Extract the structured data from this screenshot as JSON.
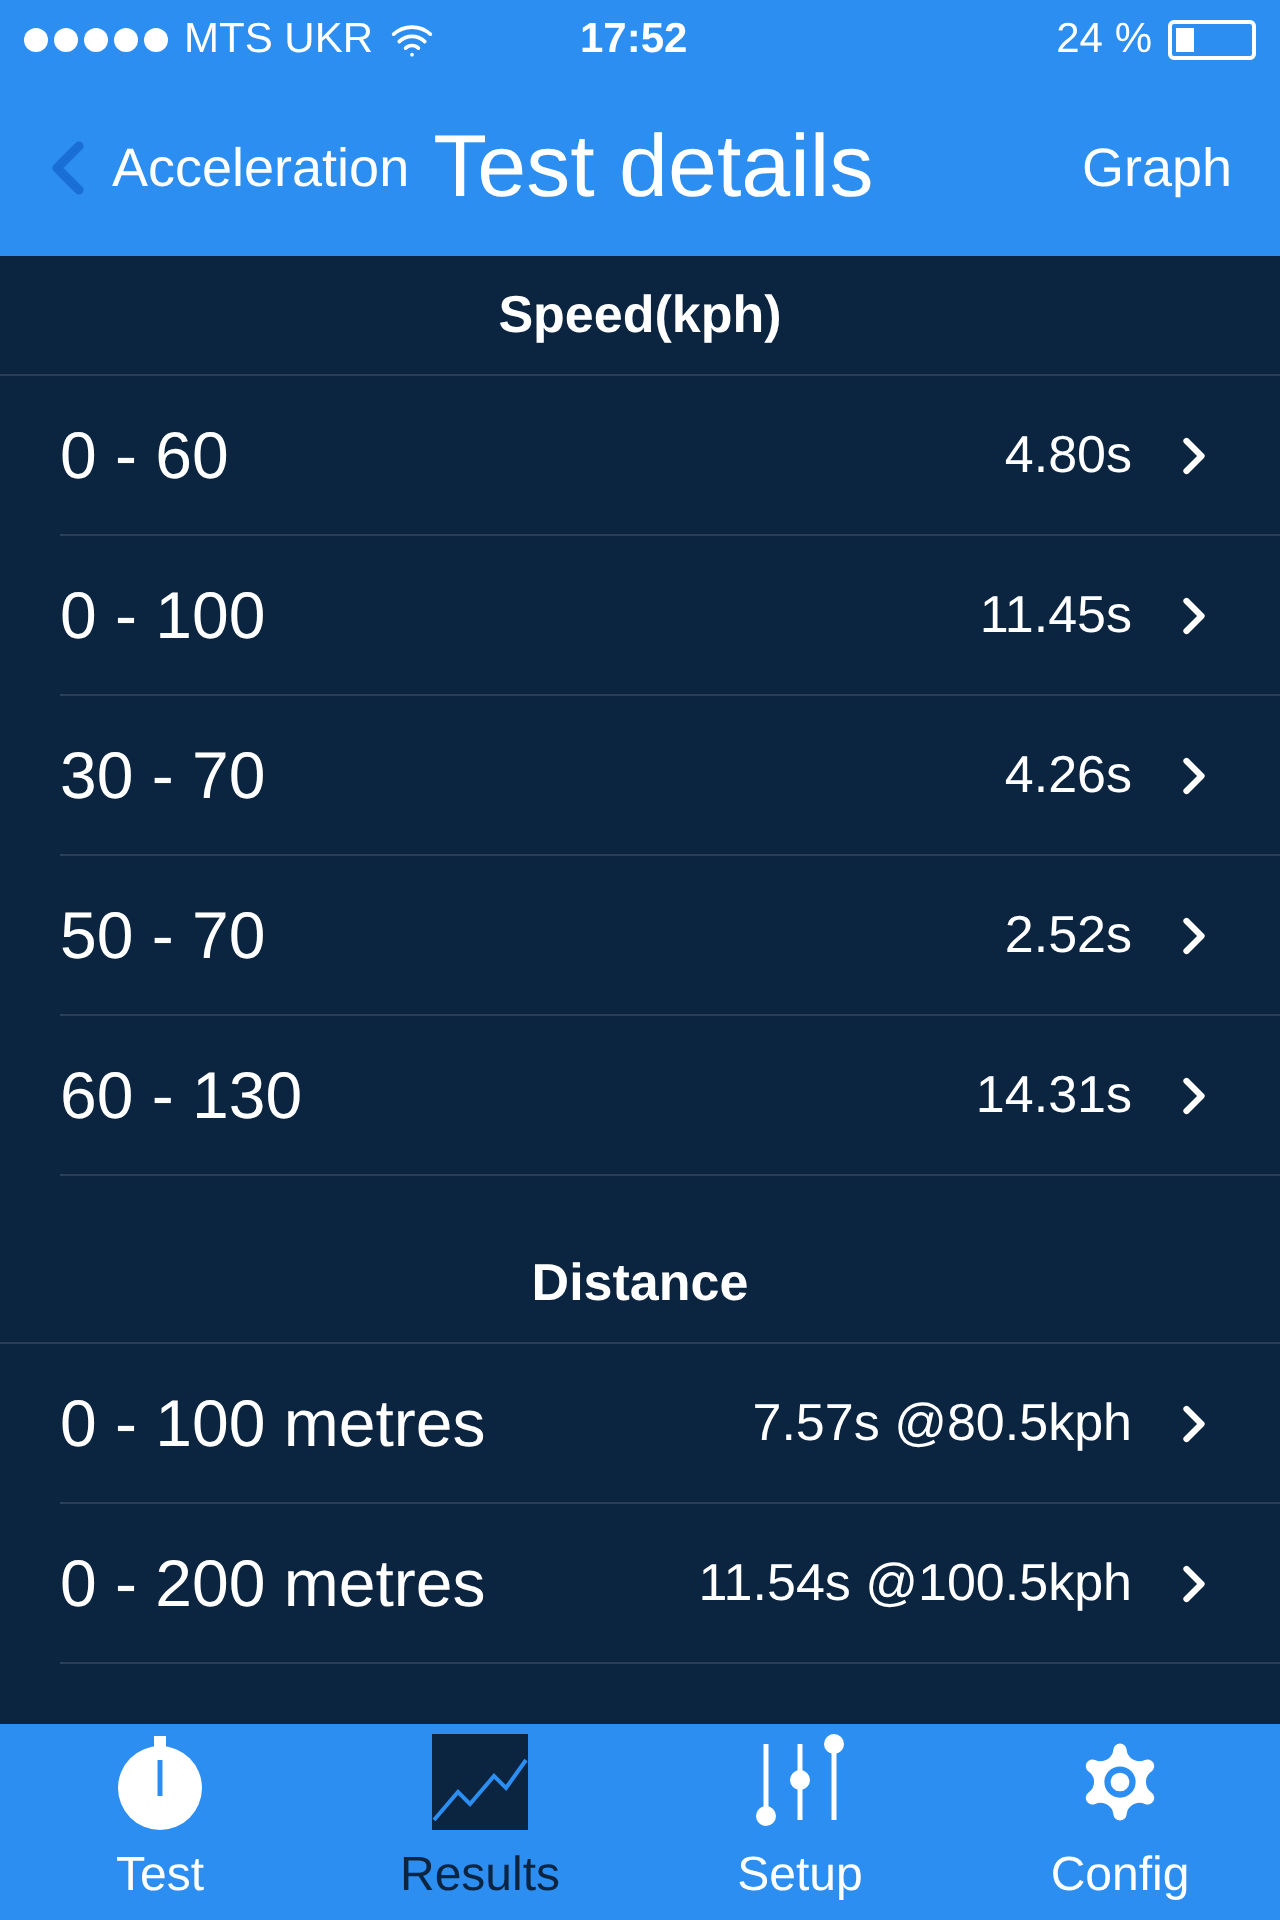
{
  "status_bar": {
    "carrier": "MTS UKR",
    "time": "17:52",
    "battery": "24 %"
  },
  "nav": {
    "back": "Acceleration",
    "title": "Test details",
    "action": "Graph"
  },
  "sections": [
    {
      "title": "Speed(kph)",
      "rows": [
        {
          "label": "0 - 60",
          "value": "4.80s"
        },
        {
          "label": "0 - 100",
          "value": "11.45s"
        },
        {
          "label": "30 - 70",
          "value": "4.26s"
        },
        {
          "label": "50 - 70",
          "value": "2.52s"
        },
        {
          "label": "60 - 130",
          "value": "14.31s"
        }
      ]
    },
    {
      "title": "Distance",
      "rows": [
        {
          "label": "0 - 100 metres",
          "value": "7.57s @80.5kph"
        },
        {
          "label": "0 - 200 metres",
          "value": "11.54s @100.5kph"
        }
      ]
    }
  ],
  "tabs": [
    {
      "kind": "stopwatch",
      "label": "Test",
      "selected": false
    },
    {
      "kind": "chart",
      "label": "Results",
      "selected": true
    },
    {
      "kind": "sliders",
      "label": "Setup",
      "selected": false
    },
    {
      "kind": "gear",
      "label": "Config",
      "selected": false
    }
  ]
}
